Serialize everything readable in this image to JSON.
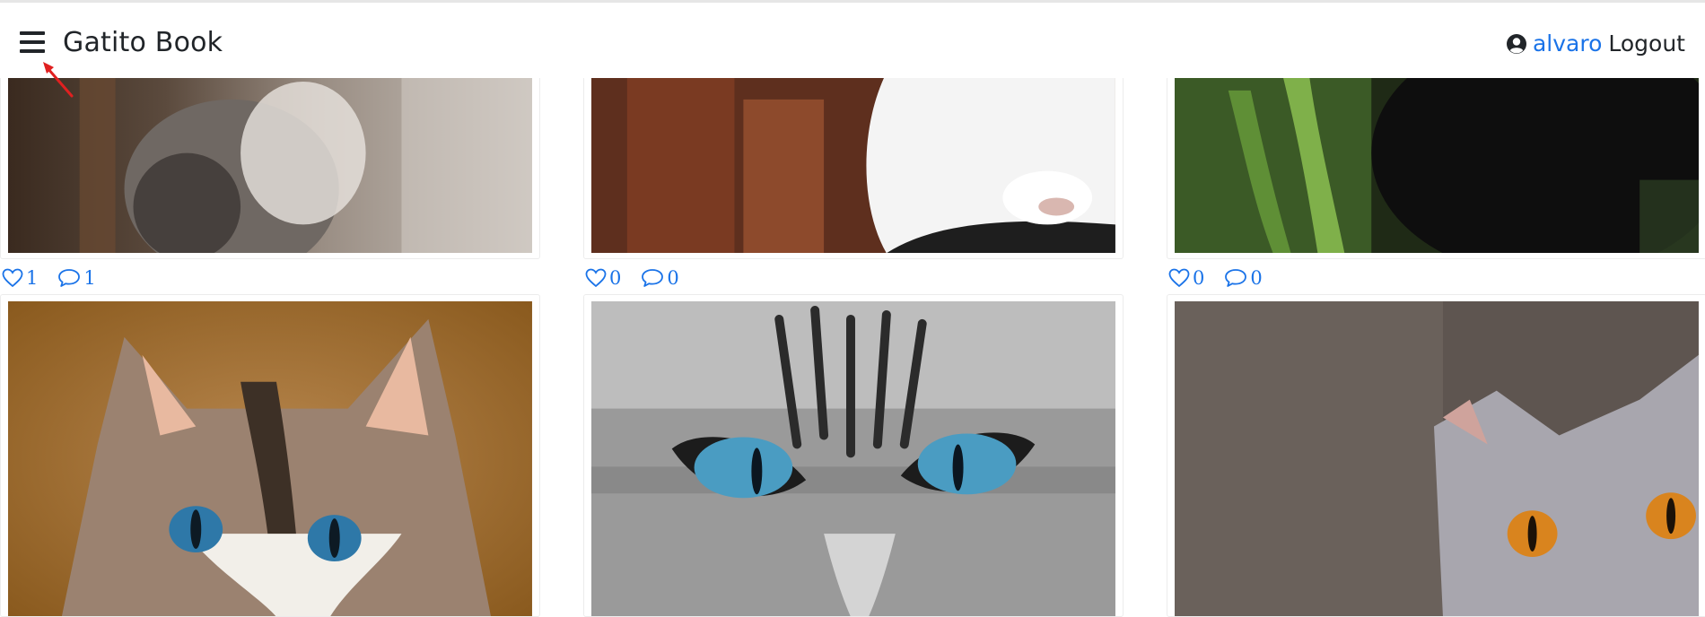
{
  "header": {
    "brand": "Gatito Book",
    "username": "alvaro",
    "logout_label": "Logout"
  },
  "colors": {
    "accent": "#1a73e8",
    "text": "#212529",
    "annotation_arrow": "#e02020"
  },
  "icons": {
    "menu": "hamburger-icon",
    "user": "user-circle-icon",
    "like": "heart-outline-icon",
    "comment": "speech-bubble-icon"
  },
  "posts": [
    {
      "likes": "1",
      "comments": "1",
      "subject": "tabby kitten"
    },
    {
      "likes": "0",
      "comments": "0",
      "subject": "white kitten"
    },
    {
      "likes": "0",
      "comments": "0",
      "subject": "black cat"
    },
    {
      "subject": "blue-eyed fluffy cat"
    },
    {
      "subject": "grey tabby eyes"
    },
    {
      "subject": "british shorthair cat"
    }
  ]
}
